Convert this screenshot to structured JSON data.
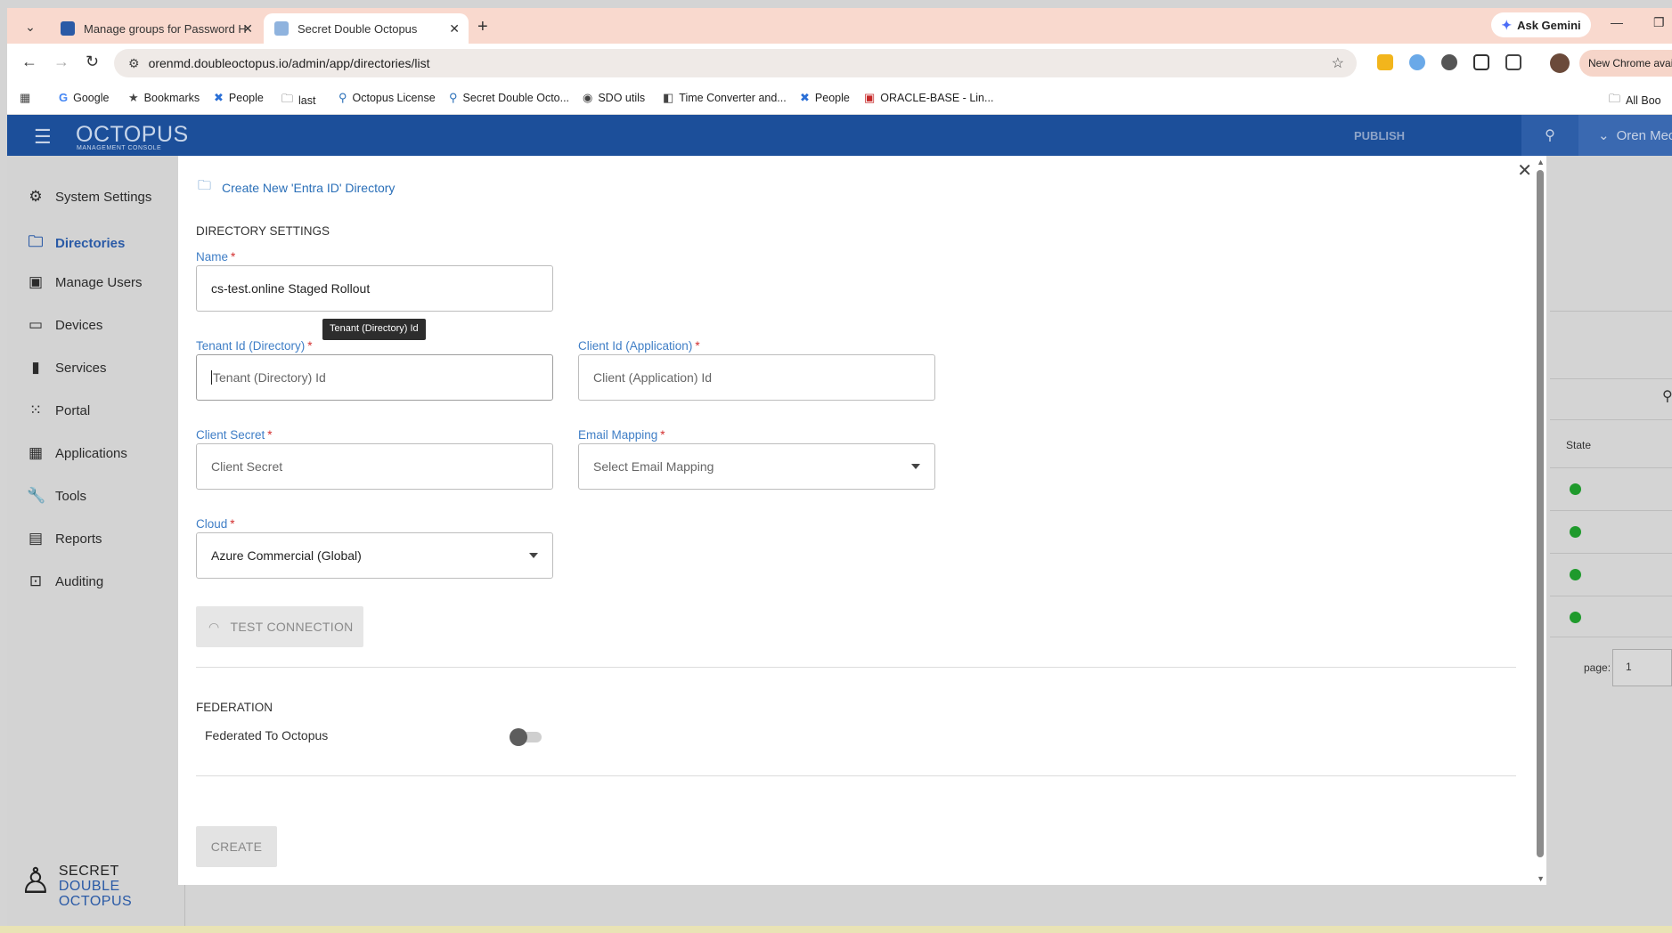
{
  "browser": {
    "tabs": [
      {
        "title": "Manage groups for Password H",
        "favicon_color": "#2a5aa6"
      },
      {
        "title": "Secret Double Octopus",
        "favicon_color": "#2a6fb8"
      }
    ],
    "ask_gemini": "Ask Gemini",
    "url": "orenmd.doubleoctopus.io/admin/app/directories/list",
    "new_chrome": "New Chrome availa",
    "bookmarks": [
      {
        "label": "Google",
        "icon": "G"
      },
      {
        "label": "Bookmarks",
        "icon": "★"
      },
      {
        "label": "People",
        "icon": "✖"
      },
      {
        "label": "last",
        "icon": "🗀"
      },
      {
        "label": "Octopus License",
        "icon": "⚲"
      },
      {
        "label": "Secret Double Octo...",
        "icon": "⚲"
      },
      {
        "label": "SDO utils",
        "icon": "◉"
      },
      {
        "label": "Time Converter and...",
        "icon": "◧"
      },
      {
        "label": "People",
        "icon": "✖"
      },
      {
        "label": "ORACLE-BASE - Lin...",
        "icon": "▣"
      }
    ],
    "all_bookmarks": "All Boo"
  },
  "app": {
    "logo_main": "OCTOPUS",
    "logo_sub": "MANAGEMENT CONSOLE",
    "publish": "PUBLISH",
    "user_name": "Oren Mec",
    "brand_color": "#1c4f9a"
  },
  "sidebar": {
    "items": [
      {
        "label": "System Settings",
        "icon": "gear-icon"
      },
      {
        "label": "Directories",
        "icon": "folder-icon"
      },
      {
        "label": "Manage Users",
        "icon": "badge-icon"
      },
      {
        "label": "Devices",
        "icon": "laptop-icon"
      },
      {
        "label": "Services",
        "icon": "bookmark-icon"
      },
      {
        "label": "Portal",
        "icon": "grid-icon"
      },
      {
        "label": "Applications",
        "icon": "apps-icon"
      },
      {
        "label": "Tools",
        "icon": "wrench-icon"
      },
      {
        "label": "Reports",
        "icon": "clipboard-icon"
      },
      {
        "label": "Auditing",
        "icon": "search-box-icon"
      }
    ],
    "active_index": 1,
    "sdo_words": [
      "SECRET",
      "DOUBLE",
      "OCTOPUS"
    ]
  },
  "background_table": {
    "column_state": "State",
    "page_label": "page:",
    "page_value": "1",
    "state_color": "#1f9a2c"
  },
  "modal": {
    "title": "Create New 'Entra ID' Directory",
    "section_directory": "DIRECTORY SETTINGS",
    "name": {
      "label": "Name",
      "value": "cs-test.online Staged Rollout"
    },
    "tooltip": "Tenant (Directory) Id",
    "tenant_id": {
      "label": "Tenant Id (Directory)",
      "placeholder": "Tenant (Directory) Id"
    },
    "client_id": {
      "label": "Client Id (Application)",
      "placeholder": "Client (Application) Id"
    },
    "client_secret": {
      "label": "Client Secret",
      "placeholder": "Client Secret"
    },
    "email_mapping": {
      "label": "Email Mapping",
      "placeholder": "Select Email Mapping"
    },
    "cloud": {
      "label": "Cloud",
      "value": "Azure Commercial (Global)"
    },
    "required_mark": "*",
    "test_connection": "TEST CONNECTION",
    "section_federation": "FEDERATION",
    "federated_label": "Federated To Octopus",
    "federated_on": false,
    "create": "CREATE",
    "label_color": "#3f7ec6",
    "required_color": "#d32f2f"
  }
}
